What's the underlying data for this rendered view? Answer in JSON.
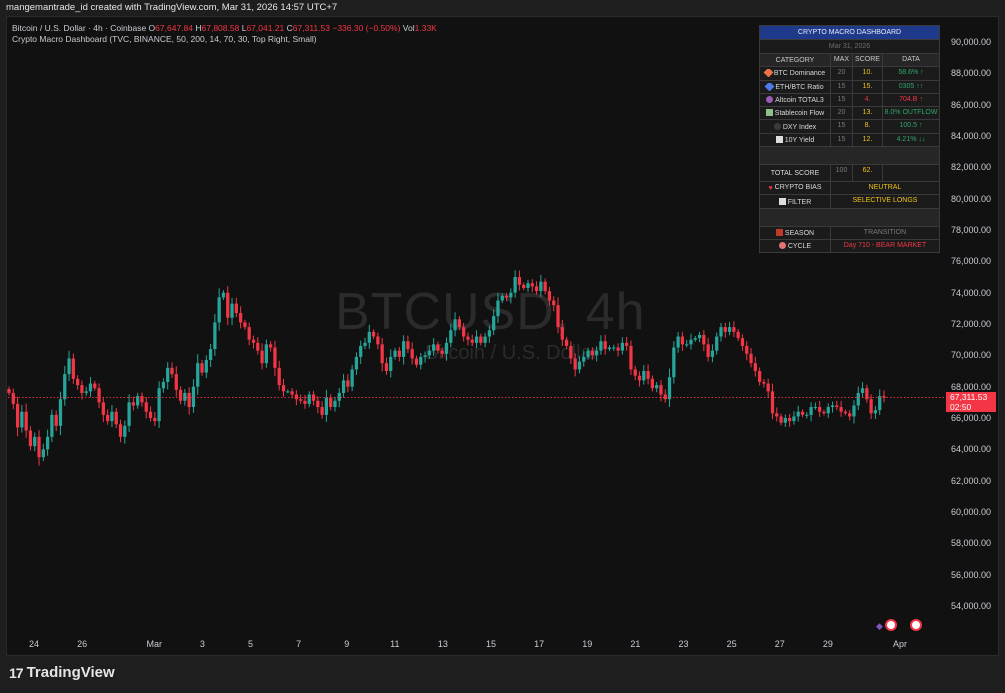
{
  "header": {
    "created_by": "mangemantrade_id created with TradingView.com, Mar 31, 2026 14:57 UTC+7"
  },
  "legend": {
    "symbol": "Bitcoin / U.S. Dollar · 4h · Coinbase",
    "o_label": "O",
    "o_value": "67,647.84",
    "h_label": "H",
    "h_value": "67,808.58",
    "l_label": "L",
    "l_value": "67,041.21",
    "c_label": "C",
    "c_value": "67,311.53",
    "change": "−336.30 (−0.50%)",
    "vol_label": "Vol",
    "vol_value": "1.33K",
    "indicator": "Crypto Macro Dashboard (TVC, BINANCE, 50, 200, 14, 70, 30, Top Right, Small)"
  },
  "watermark": {
    "symbol": "BTCUSD, 4h",
    "name": "Bitcoin / U.S. Dollar"
  },
  "price_label": {
    "price": "67,311.53",
    "countdown": "02:50"
  },
  "dashboard": {
    "title": "CRYPTO MACRO DASHBOARD",
    "date": "Mar 31, 2026",
    "headers": [
      "CATEGORY",
      "MAX",
      "SCORE",
      "DATA"
    ],
    "rows": [
      {
        "icon": "diamond-orange-icon",
        "category": "BTC Dominance",
        "max": "20",
        "score": "10.",
        "data": "58.6% ↑"
      },
      {
        "icon": "diamond-blue-icon",
        "category": "ETH/BTC Ratio",
        "max": "15",
        "score": "15.",
        "data": "0305 ↑↑"
      },
      {
        "icon": "circle-purple-icon",
        "category": "Altcoin TOTAL3",
        "max": "15",
        "score": "4.",
        "data": "704.B ↑"
      },
      {
        "icon": "money-icon",
        "category": "Stablecoin Flow",
        "max": "20",
        "score": "13.",
        "data": "8.0% OUTFLOW"
      },
      {
        "icon": "dollar-icon",
        "category": "DXY Index",
        "max": "15",
        "score": "8.",
        "data": "100.5 ↑"
      },
      {
        "icon": "chart-icon",
        "category": "10Y Yield",
        "max": "15",
        "score": "12.",
        "data": "4.21% ↓↓"
      }
    ],
    "total_label": "TOTAL SCORE",
    "total_max": "100",
    "total_score": "62.",
    "bias_label": "CRYPTO BIAS",
    "bias_value": "NEUTRAL",
    "filter_label": "FILTER",
    "filter_value": "SELECTIVE LONGS",
    "season_label": "SEASON",
    "season_value": "TRANSITION",
    "cycle_label": "CYCLE",
    "cycle_value": "Day 710 - BEAR MARKET"
  },
  "footer": {
    "brand": "TradingView"
  },
  "colors": {
    "up": "#26a69a",
    "down": "#f23645",
    "background": "#111111"
  },
  "chart_data": {
    "type": "candlestick",
    "y_ticks": [
      "90,000.00",
      "88,000.00",
      "86,000.00",
      "84,000.00",
      "82,000.00",
      "80,000.00",
      "78,000.00",
      "76,000.00",
      "74,000.00",
      "72,000.00",
      "70,000.00",
      "68,000.00",
      "66,000.00",
      "64,000.00",
      "62,000.00",
      "60,000.00",
      "58,000.00",
      "56,000.00",
      "54,000.00"
    ],
    "y_tick_values": [
      90000,
      88000,
      86000,
      84000,
      82000,
      80000,
      78000,
      76000,
      74000,
      72000,
      70000,
      68000,
      66000,
      64000,
      62000,
      60000,
      58000,
      56000,
      54000
    ],
    "x_ticks": [
      "24",
      "26",
      "Mar",
      "3",
      "5",
      "7",
      "9",
      "11",
      "13",
      "15",
      "17",
      "19",
      "21",
      "23",
      "25",
      "27",
      "29",
      "Apr"
    ],
    "x_tick_days": [
      0,
      2,
      5,
      7,
      9,
      11,
      13,
      15,
      17,
      19,
      21,
      23,
      25,
      27,
      29,
      31,
      33,
      36
    ],
    "ylim": [
      53000,
      91500
    ],
    "last_price": 67311.53,
    "closes": [
      67600,
      66900,
      65400,
      66400,
      65200,
      64200,
      64800,
      63500,
      64000,
      64800,
      66200,
      65500,
      67200,
      68800,
      69800,
      68500,
      68100,
      67600,
      67700,
      68200,
      67900,
      67000,
      66200,
      65800,
      66400,
      65600,
      64800,
      65500,
      67000,
      66800,
      67400,
      67000,
      66400,
      66000,
      65800,
      67900,
      68300,
      69200,
      68800,
      67800,
      67100,
      67600,
      66700,
      68000,
      69500,
      68900,
      69700,
      70400,
      72100,
      73700,
      74000,
      72400,
      73300,
      72700,
      72100,
      71800,
      71000,
      70800,
      70300,
      69500,
      70700,
      70500,
      69200,
      68100,
      67700,
      67700,
      67500,
      67200,
      67100,
      66900,
      67500,
      67100,
      66700,
      66200,
      67300,
      66700,
      67100,
      67600,
      68400,
      68000,
      69100,
      69900,
      70600,
      70800,
      71500,
      71200,
      70700,
      69500,
      69000,
      69900,
      70300,
      69900,
      70900,
      70400,
      69800,
      69400,
      69900,
      70000,
      70300,
      70700,
      70300,
      70100,
      70800,
      71600,
      72300,
      71800,
      71200,
      71000,
      70800,
      71200,
      70800,
      71200,
      71600,
      72500,
      73500,
      73800,
      73700,
      74000,
      75000,
      74500,
      74300,
      74600,
      74400,
      74100,
      74700,
      74100,
      73500,
      73200,
      71800,
      71000,
      70600,
      69800,
      69100,
      69600,
      69900,
      70300,
      70000,
      70300,
      70900,
      70400,
      70500,
      70500,
      70300,
      70800,
      70600,
      69100,
      68700,
      68400,
      69000,
      68500,
      67900,
      68100,
      67500,
      67200,
      68600,
      70500,
      71200,
      70700,
      70700,
      71000,
      71100,
      71300,
      70700,
      69900,
      70300,
      71200,
      71800,
      71500,
      71800,
      71500,
      71100,
      70600,
      70100,
      69500,
      69000,
      68300,
      68200,
      67700,
      66300,
      66100,
      65700,
      66000,
      65800,
      66100,
      66400,
      66200,
      66200,
      66700,
      66700,
      66400,
      66300,
      66700,
      66800,
      66700,
      66400,
      66300,
      66100,
      66800,
      67600,
      67900,
      67200,
      66300,
      66500,
      67400,
      67300
    ]
  }
}
